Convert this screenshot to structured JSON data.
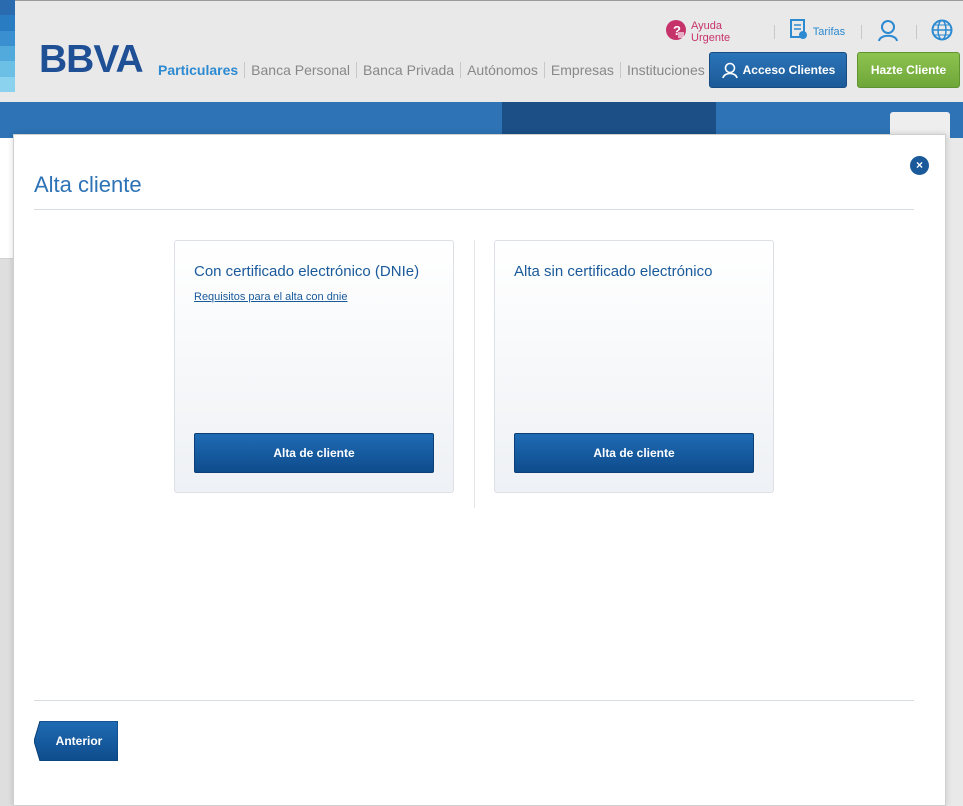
{
  "header": {
    "logo": "BBVA",
    "segments": [
      "Particulares",
      "Banca Personal",
      "Banca Privada",
      "Autónomos",
      "Empresas",
      "Instituciones"
    ],
    "toplinks": {
      "ayuda": "Ayuda Urgente",
      "tarifas": "Tarifas"
    },
    "acceso_label": "Acceso Clientes",
    "hazte_label": "Hazte Cliente"
  },
  "colors": {
    "brand_blue": "#1f4f95",
    "accent_blue": "#2d73b5",
    "green": "#7ab543",
    "ayuda_pink": "#c6336b"
  },
  "icons": {
    "ayuda": "help-urgent-icon",
    "tarifas": "document-icon",
    "user": "user-icon",
    "globe": "globe-icon",
    "close": "close-icon"
  },
  "modal": {
    "title": "Alta cliente",
    "close_glyph": "×",
    "cards": [
      {
        "title": "Con certificado electrónico (DNIe)",
        "link": "Requisitos para el alta con dnie",
        "button": "Alta de cliente"
      },
      {
        "title": "Alta sin certificado electrónico",
        "button": "Alta de cliente"
      }
    ],
    "back_button": "Anterior"
  }
}
